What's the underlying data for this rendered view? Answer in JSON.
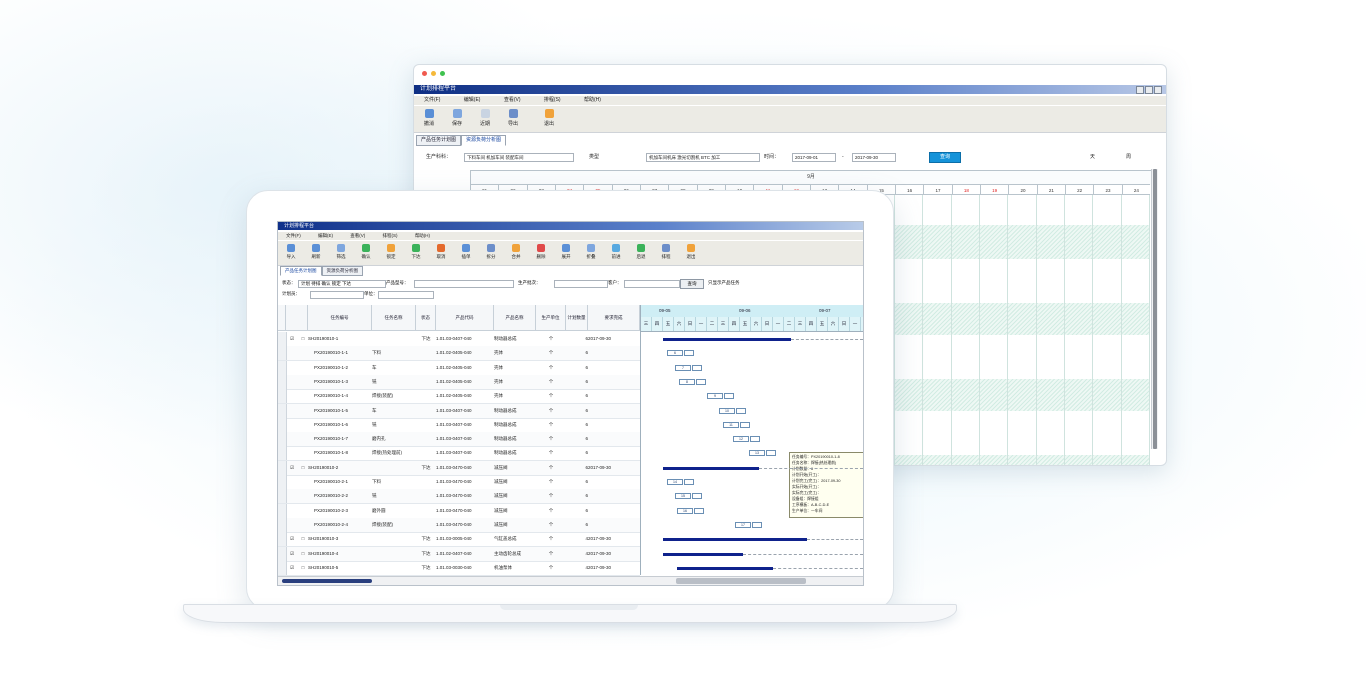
{
  "back_window": {
    "title": "计划排程平台",
    "menu": [
      "文件(F)",
      "编辑(E)",
      "查看(V)",
      "排程(S)",
      "帮助(H)"
    ],
    "toolbar": [
      "撤消",
      "保存",
      "近期",
      "导出",
      "退出"
    ],
    "tabs": [
      "产品任务计划图",
      "资源负荷分析图"
    ],
    "active_tab": 1,
    "filter": {
      "label_resource": "生产科科：",
      "resource_value": "下料车间 机加车间 装配车间",
      "label_type": "类型",
      "type_value": "机加车间机床 激光切割机 BTC 加工",
      "label_date": "时间：",
      "date_from": "2017-09-01",
      "date_to": "2017-09-30",
      "query_button": "查询",
      "option_day": "天",
      "option_week": "周"
    },
    "month_label": "9月",
    "days": [
      "01",
      "02",
      "03",
      "04",
      "05",
      "06",
      "07",
      "08",
      "09",
      "10",
      "11",
      "12",
      "13",
      "14",
      "15",
      "16",
      "17",
      "18",
      "19",
      "20",
      "21",
      "22",
      "23",
      "24"
    ],
    "weekend_days": [
      "04",
      "05",
      "11",
      "12",
      "18",
      "19"
    ]
  },
  "laptop_window": {
    "title": "计划排程平台",
    "menu": [
      "文件(F)",
      "编辑(E)",
      "查看(V)",
      "排程(S)",
      "帮助(H)"
    ],
    "toolbar": [
      "导入",
      "刷新",
      "筛选",
      "确认",
      "锁定",
      "下达",
      "取消",
      "插单",
      "拆分",
      "合并",
      "删除",
      "展开",
      "折叠",
      "前进",
      "后退",
      "排程",
      "退出"
    ],
    "tabs": [
      "产品任务计划图",
      "资源负荷分析图"
    ],
    "active_tab": 0,
    "filter": {
      "label_status": "状态：",
      "status_value": "计划 待排 确认 锁定 下达",
      "label_product": "产品型号：",
      "product_value": "",
      "label_order": "生产批次：",
      "order_value": "",
      "label_customer": "客户：",
      "customer_value": "",
      "search_button": "查询",
      "option_label": "只显示产品任务",
      "label_plan": "计划员：",
      "plan_value": "",
      "label_unit": "单位：",
      "unit_value": ""
    },
    "table": {
      "headers": [
        "",
        "任务编号",
        "任务名称",
        "状态",
        "产品代码",
        "产品名称",
        "生产单位",
        "计划数量",
        "要求完成"
      ],
      "rows": [
        {
          "check": "☑",
          "expand": "□",
          "id": "SH20190010-1",
          "name": "",
          "status": "下达",
          "code": "1.01.03-0407-040",
          "pname": "制动器总成",
          "unit": "个",
          "qty": "6",
          "due": "2017-09-30",
          "indent": false
        },
        {
          "check": "",
          "expand": "",
          "id": "PX20190010-1-1",
          "name": "下料",
          "status": "",
          "code": "1.01.02-0405-040",
          "pname": "壳体",
          "unit": "个",
          "qty": "6",
          "due": "",
          "indent": true
        },
        {
          "check": "",
          "expand": "",
          "id": "PX20190010-1-2",
          "name": "车",
          "status": "",
          "code": "1.01.02-0405-040",
          "pname": "壳体",
          "unit": "个",
          "qty": "6",
          "due": "",
          "indent": true
        },
        {
          "check": "",
          "expand": "",
          "id": "PX20190010-1-3",
          "name": "铣",
          "status": "",
          "code": "1.01.02-0405-040",
          "pname": "壳体",
          "unit": "个",
          "qty": "6",
          "due": "",
          "indent": true
        },
        {
          "check": "",
          "expand": "",
          "id": "PX20190010-1-4",
          "name": "焊接(装配)",
          "status": "",
          "code": "1.01.02-0405-040",
          "pname": "壳体",
          "unit": "个",
          "qty": "6",
          "due": "",
          "indent": true
        },
        {
          "check": "",
          "expand": "",
          "id": "PX20190010-1-5",
          "name": "车",
          "status": "",
          "code": "1.01.03-0407-040",
          "pname": "制动器总成",
          "unit": "个",
          "qty": "6",
          "due": "",
          "indent": true
        },
        {
          "check": "",
          "expand": "",
          "id": "PX20190010-1-6",
          "name": "铣",
          "status": "",
          "code": "1.01.03-0407-040",
          "pname": "制动器总成",
          "unit": "个",
          "qty": "6",
          "due": "",
          "indent": true
        },
        {
          "check": "",
          "expand": "",
          "id": "PX20190010-1-7",
          "name": "磨内孔",
          "status": "",
          "code": "1.01.03-0407-040",
          "pname": "制动器总成",
          "unit": "个",
          "qty": "6",
          "due": "",
          "indent": true
        },
        {
          "check": "",
          "expand": "",
          "id": "PX20190010-1-8",
          "name": "焊接(热处理前)",
          "status": "",
          "code": "1.01.03-0407-040",
          "pname": "制动器总成",
          "unit": "个",
          "qty": "6",
          "due": "",
          "indent": true
        },
        {
          "check": "☑",
          "expand": "□",
          "id": "SH20190010-2",
          "name": "",
          "status": "下达",
          "code": "1.01.03-0470-040",
          "pname": "减压阀",
          "unit": "个",
          "qty": "6",
          "due": "2017-09-30",
          "indent": false
        },
        {
          "check": "",
          "expand": "",
          "id": "PX20190010-2-1",
          "name": "下料",
          "status": "",
          "code": "1.01.03-0470-040",
          "pname": "减压阀",
          "unit": "个",
          "qty": "6",
          "due": "",
          "indent": true
        },
        {
          "check": "",
          "expand": "",
          "id": "PX20190010-2-2",
          "name": "铣",
          "status": "",
          "code": "1.01.03-0470-040",
          "pname": "减压阀",
          "unit": "个",
          "qty": "6",
          "due": "",
          "indent": true
        },
        {
          "check": "",
          "expand": "",
          "id": "PX20190010-2-3",
          "name": "磨外圆",
          "status": "",
          "code": "1.01.03-0470-040",
          "pname": "减压阀",
          "unit": "个",
          "qty": "6",
          "due": "",
          "indent": true
        },
        {
          "check": "",
          "expand": "",
          "id": "PX20190010-2-4",
          "name": "焊接(装配)",
          "status": "",
          "code": "1.01.03-0470-040",
          "pname": "减压阀",
          "unit": "个",
          "qty": "6",
          "due": "",
          "indent": true
        },
        {
          "check": "☑",
          "expand": "□",
          "id": "SH20190010-3",
          "name": "",
          "status": "下达",
          "code": "1.01.03-0005-040",
          "pname": "气缸盖总成",
          "unit": "个",
          "qty": "4",
          "due": "2017-09-30",
          "indent": false
        },
        {
          "check": "☑",
          "expand": "□",
          "id": "SH20190010-4",
          "name": "",
          "status": "下达",
          "code": "1.01.02-0407-040",
          "pname": "主动齿轮总成",
          "unit": "个",
          "qty": "4",
          "due": "2017-09-30",
          "indent": false
        },
        {
          "check": "☑",
          "expand": "□",
          "id": "SH20190010-5",
          "name": "",
          "status": "下达",
          "code": "1.01.03-0030-040",
          "pname": "机油泵体",
          "unit": "个",
          "qty": "4",
          "due": "2017-09-30",
          "indent": false
        }
      ]
    },
    "gantt": {
      "header_top": [
        "09-05",
        "09-06",
        "09-07"
      ],
      "header_days": [
        "三",
        "四",
        "五",
        "六",
        "日",
        "一",
        "二",
        "三",
        "四",
        "五",
        "六",
        "日",
        "一",
        "二",
        "三",
        "四",
        "五",
        "六",
        "日",
        "一"
      ],
      "task_boxes": [
        "6",
        "7",
        "8",
        "9",
        "10",
        "11",
        "12",
        "13",
        "14",
        "15",
        "16",
        "17"
      ],
      "tooltip": [
        "任务编号：PX20190010-1-8",
        "任务名称：焊接(热处理前)",
        "计划数量：6",
        "计划开始(开工)：",
        "计划完工(完工)：2017-09-30",
        "实际开始(开工)：",
        "实际完工(完工)：",
        "设备组：焊接组",
        "工序模板：A-B-C-D-E",
        "生产单位：一车间"
      ]
    }
  }
}
